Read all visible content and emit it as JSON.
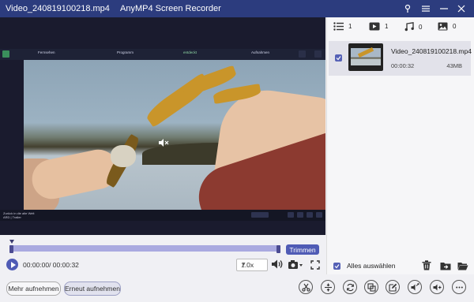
{
  "window": {
    "file_title": "Video_240819100218.mp4",
    "app_title": "AnyMP4 Screen Recorder"
  },
  "embedded_video": {
    "browser_tabs": [
      "Fernsehen",
      "Programm",
      "entdeckt",
      "Aufnahmen"
    ],
    "caption": "Zurück in die alte Welt",
    "caption_sub": "ARD | Trailer",
    "mute_icon": "speaker-muted-icon"
  },
  "player": {
    "trim_label": "Trimmen",
    "time_display": "00:00:00/ 00:00:32",
    "progress": 0.0,
    "speed": "1.0x"
  },
  "bottom_buttons": {
    "record_more": "Mehr aufnehmen",
    "record_again": "Erneut aufnehmen"
  },
  "filters": [
    {
      "icon": "list-icon",
      "count": "1"
    },
    {
      "icon": "video-icon",
      "count": "1"
    },
    {
      "icon": "music-icon",
      "count": "0"
    },
    {
      "icon": "image-icon",
      "count": "0"
    }
  ],
  "files": [
    {
      "name": "Video_240819100218.mp4",
      "duration": "00:00:32",
      "size": "43MB",
      "checked": true
    }
  ],
  "select_all_label": "Alles auswählen",
  "colors": {
    "titlebar": "#2c3c7e",
    "accent": "#4f5bb5",
    "timeline": "#a9a9e0"
  }
}
